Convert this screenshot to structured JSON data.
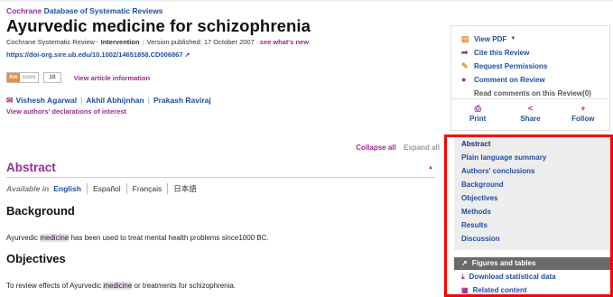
{
  "header": {
    "brand_prefix": "Cochrane",
    "brand_suffix": "Database of Systematic Reviews",
    "title": "Ayurvedic medicine for schizophrenia",
    "review_type_prefix": "Cochrane Systematic Review - ",
    "review_type": "Intervention",
    "version_published": "Version published: 17 October 2007",
    "whats_new": "see what's new",
    "doi": "https://doi-org.sire.ub.edu/10.1002/14651858.CD006867",
    "altmetric_label_am": "Am",
    "altmetric_label_score": "score",
    "altmetric_score": "18",
    "view_article_info": "View article information",
    "authors": [
      "Vishesh Agarwal",
      "Akhil Abhijnhan",
      "Prakash Raviraj"
    ],
    "declarations": "View authors' declarations of interest"
  },
  "controls": {
    "collapse_all": "Collapse all",
    "expand_all": "Expand all"
  },
  "abstract": {
    "heading": "Abstract",
    "available_in_label": "Available in",
    "languages": [
      "English",
      "Español",
      "Français",
      "日本語"
    ],
    "background_heading": "Background",
    "background_pre": "Ayurvedic ",
    "background_hl": "medicine",
    "background_post": " has been used to treat mental health problems since1000 BC.",
    "objectives_heading": "Objectives",
    "objectives_pre": "To review effects of Ayurvedic ",
    "objectives_hl": "medicine",
    "objectives_post": " or treatments for schizophrenia."
  },
  "sidebar": {
    "view_pdf": "View PDF",
    "cite": "Cite this Review",
    "permissions": "Request Permissions",
    "comment": "Comment on Review",
    "read_comments": "Read comments on this Review(0)",
    "print": "Print",
    "share": "Share",
    "follow": "Follow"
  },
  "toc": {
    "items": [
      "Abstract",
      "Plain language summary",
      "Authors' conclusions",
      "Background",
      "Objectives",
      "Methods",
      "Results",
      "Discussion"
    ],
    "figures": "Figures and tables",
    "download": "Download statistical data",
    "related": "Related content"
  },
  "colors": {
    "cochrane_purple": "#962d91",
    "link_blue": "#1f4ea3",
    "highlight_box": "#ff0000"
  }
}
